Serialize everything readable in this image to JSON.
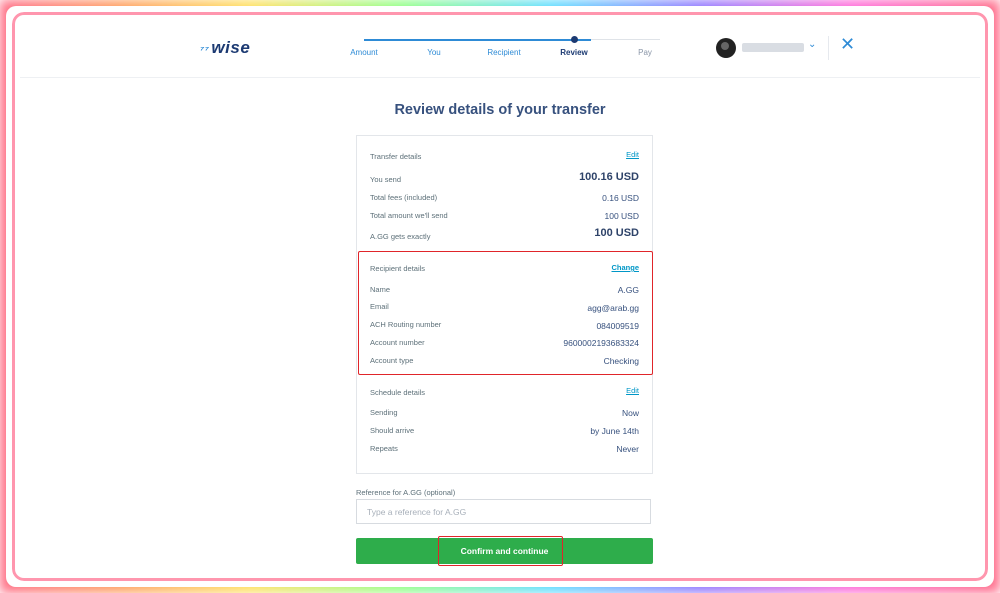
{
  "brand": {
    "logo_text": "wise",
    "logo_mark": "⁷⁷"
  },
  "progress": {
    "steps": [
      "Amount",
      "You",
      "Recipient",
      "Review",
      "Pay"
    ],
    "current": "Review"
  },
  "header": {
    "chevron": "⌄",
    "close": "✕"
  },
  "page_title": "Review details of your transfer",
  "transfer": {
    "title": "Transfer details",
    "edit": "Edit",
    "rows": [
      {
        "label": "You send",
        "value": "100.16 USD"
      },
      {
        "label": "Total fees (included)",
        "value": "0.16 USD"
      },
      {
        "label": "Total amount we'll send",
        "value": "100 USD"
      },
      {
        "label": "A.GG gets exactly",
        "value": "100 USD"
      }
    ]
  },
  "recipient": {
    "title": "Recipient details",
    "change": "Change",
    "rows": [
      {
        "label": "Name",
        "value": "A.GG"
      },
      {
        "label": "Email",
        "value": "agg@arab.gg"
      },
      {
        "label": "ACH Routing number",
        "value": "084009519"
      },
      {
        "label": "Account number",
        "value": "9600002193683324"
      },
      {
        "label": "Account type",
        "value": "Checking"
      }
    ]
  },
  "schedule": {
    "title": "Schedule details",
    "edit": "Edit",
    "rows": [
      {
        "label": "Sending",
        "value": "Now"
      },
      {
        "label": "Should arrive",
        "value": "by June 14th"
      },
      {
        "label": "Repeats",
        "value": "Never"
      }
    ]
  },
  "reference": {
    "label": "Reference for A.GG (optional)",
    "placeholder": "Type a reference for A.GG",
    "value": ""
  },
  "confirm_label": "Confirm and continue",
  "colors": {
    "accent": "#2e8bd6",
    "navy": "#37517e",
    "green": "#2ead4b",
    "highlight": "#e0252a"
  }
}
